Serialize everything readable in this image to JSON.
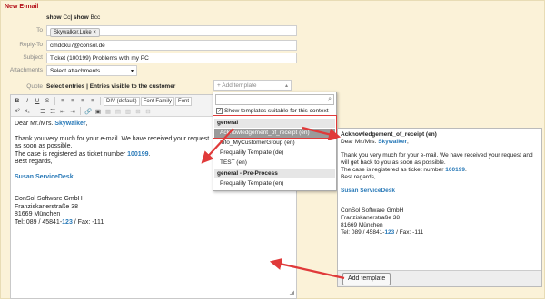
{
  "panel": {
    "title": "New E-mail"
  },
  "show_links": {
    "prefix": "show",
    "cc": "Cc",
    "sep": "|",
    "bcc_prefix": "show",
    "bcc": "Bcc"
  },
  "fields": {
    "to": {
      "label": "To",
      "token": "Skywalker,Luke ×"
    },
    "reply_to": {
      "label": "Reply-To",
      "value": "cmdoku7@consol.de"
    },
    "subject": {
      "label": "Subject",
      "value": "Ticket (100199) Problems with my PC"
    },
    "attachments": {
      "label": "Attachments",
      "value": "Select attachments"
    }
  },
  "quote": {
    "label": "Quote",
    "text": "Select entries | Entries visible to the customer"
  },
  "add_template_top": {
    "placeholder": "+ Add template"
  },
  "toolbar": {
    "bold": "B",
    "italic": "I",
    "underline": "U",
    "strike": "S",
    "format_select": "DIV (default)",
    "font_select": "Font Family",
    "font_size": "Font"
  },
  "editor": {
    "line1_prefix": "Dear Mr./Mrs.",
    "line1_name": "Skywalker",
    "line1_suffix": ",",
    "line2": "Thank you very much for your e-mail. We have received your request",
    "line3": "as soon as possible.",
    "line4_prefix": "The case is registered as ticket number",
    "line4_number": "100199",
    "line4_suffix": ".",
    "line5": "Best regards,",
    "signature_name": "Susan ServiceDesk",
    "company": "ConSol Software GmbH",
    "street": "Franziskanerstraße 38",
    "city": "81669 München",
    "tel_prefix": "Tel: 089 / 45841-",
    "tel_ext": "123",
    "tel_suffix": " / Fax: -111"
  },
  "dropdown": {
    "search_value": "",
    "checkbox_label": "Show templates suitable for this context",
    "groups": [
      {
        "name": "general",
        "items": [
          "Acknowledgement_of_receipt (en)",
          "Info_MyCustomerGroup (en)",
          "Prequalify Template (de)",
          "TEST (en)"
        ]
      },
      {
        "name": "general - Pre-Process",
        "items": [
          "Prequalify Template (en)"
        ]
      }
    ]
  },
  "preview": {
    "title": "Acknowledgement_of_receipt (en)",
    "line1_prefix": "Dear Mr./Mrs.",
    "line1_name": "Skywalker",
    "line1_suffix": ",",
    "line2": "Thank you very much for your e-mail. We have received your request and",
    "line3": "will get back to you as soon as possible.",
    "line4_prefix": "The case is registered as ticket number",
    "line4_number": "100199",
    "line4_suffix": ".",
    "line5": "Best regards,",
    "signature_name": "Susan ServiceDesk",
    "company": "ConSol Software GmbH",
    "street": "Franziskanerstraße 38",
    "city": "81669 München",
    "tel_prefix": "Tel: 089 / 45841-",
    "tel_ext": "123",
    "tel_suffix": " / Fax: -111",
    "button": "Add template"
  },
  "colors": {
    "accent": "#2a7ab8",
    "arrow": "#e03a3a",
    "panel_bg": "#fbf2d8",
    "title": "#b5121b"
  }
}
